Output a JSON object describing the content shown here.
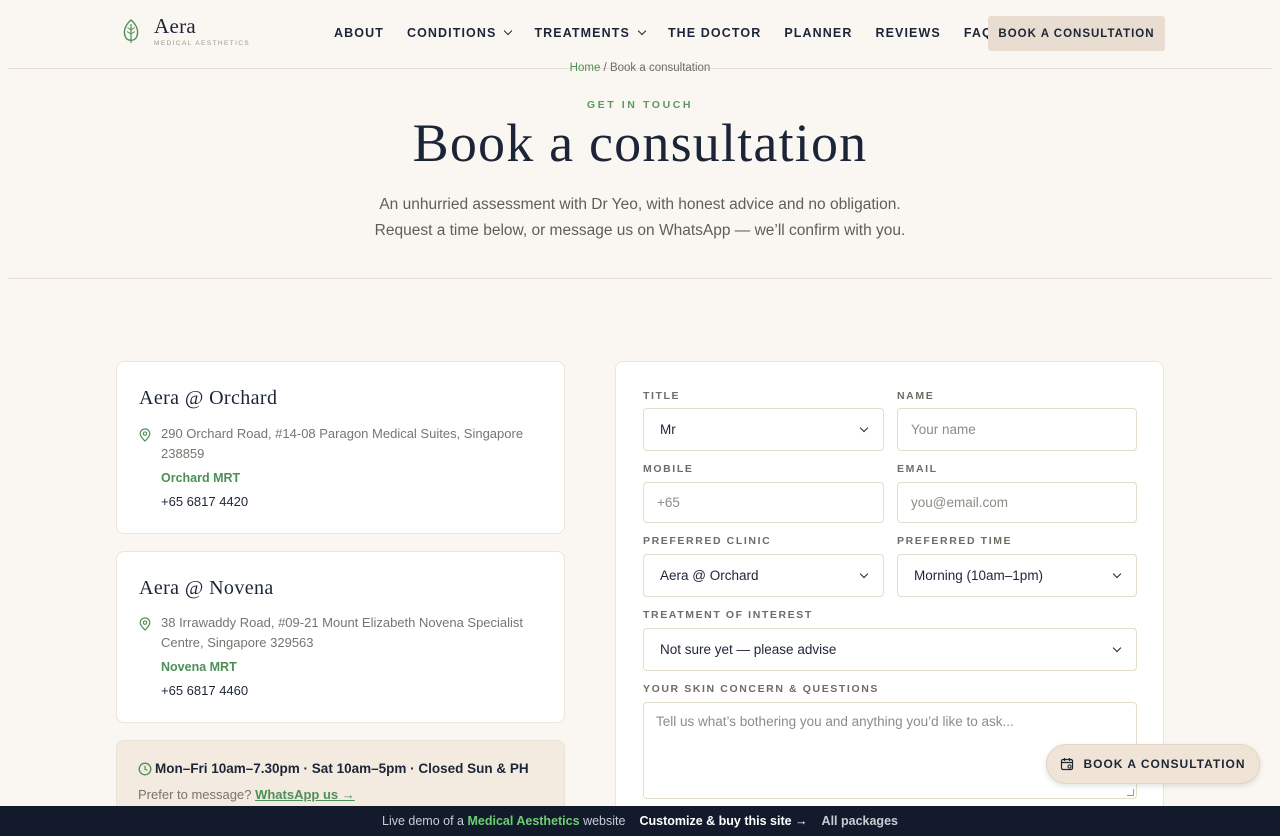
{
  "header": {
    "logo_name": "Aera",
    "logo_sub": "MEDICAL AESTHETICS",
    "nav": [
      {
        "label": "ABOUT",
        "dropdown": false
      },
      {
        "label": "CONDITIONS",
        "dropdown": true
      },
      {
        "label": "TREATMENTS",
        "dropdown": true
      },
      {
        "label": "THE DOCTOR",
        "dropdown": false
      },
      {
        "label": "PLANNER",
        "dropdown": false
      },
      {
        "label": "REVIEWS",
        "dropdown": false
      },
      {
        "label": "FAQ",
        "dropdown": false
      }
    ],
    "cta": "BOOK A CONSULTATION"
  },
  "breadcrumb": {
    "home": "Home",
    "separator": " / ",
    "current": "Book a consultation"
  },
  "hero": {
    "eyebrow": "GET IN TOUCH",
    "title": "Book a consultation",
    "subtitle_line1": "An unhurried assessment with Dr Yeo, with honest advice and no obligation.",
    "subtitle_line2": "Request a time below, or message us on WhatsApp — we’ll confirm with you."
  },
  "clinics": [
    {
      "name": "Aera @ Orchard",
      "address": "290 Orchard Road, #14-08 Paragon Medical Suites, Singapore 238859",
      "mrt": "Orchard MRT",
      "phone": "+65 6817 4420"
    },
    {
      "name": "Aera @ Novena",
      "address": "38 Irrawaddy Road, #09-21 Mount Elizabeth Novena Specialist Centre, Singapore 329563",
      "mrt": "Novena MRT",
      "phone": "+65 6817 4460"
    }
  ],
  "hours": {
    "text": "Mon–Fri 10am–7.30pm · Sat 10am–5pm · Closed Sun & PH",
    "message_prefix": "Prefer to message?",
    "whatsapp_link": "WhatsApp us →"
  },
  "form": {
    "title_label": "TITLE",
    "title_value": "Mr",
    "name_label": "NAME",
    "name_placeholder": "Your name",
    "mobile_label": "MOBILE",
    "mobile_placeholder": "+65",
    "email_label": "EMAIL",
    "email_placeholder": "you@email.com",
    "clinic_label": "PREFERRED CLINIC",
    "clinic_value": "Aera @ Orchard",
    "time_label": "PREFERRED TIME",
    "time_value": "Morning (10am–1pm)",
    "treatment_label": "TREATMENT OF INTEREST",
    "treatment_value": "Not sure yet — please advise",
    "concern_label": "YOUR SKIN CONCERN & QUESTIONS",
    "concern_placeholder": "Tell us what’s bothering you and anything you’d like to ask..."
  },
  "floating_cta": "BOOK A CONSULTATION",
  "demo_bar": {
    "prefix": "Live demo of a",
    "highlight": "Medical Aesthetics",
    "suffix": "website",
    "customize": "Customize & buy this site →",
    "packages": "All packages"
  },
  "colors": {
    "accent_green": "#4d8f57",
    "navy": "#1c2538",
    "beige_button": "#e8ddd0",
    "background": "#faf7f2",
    "demo_bar": "#121a2b"
  }
}
